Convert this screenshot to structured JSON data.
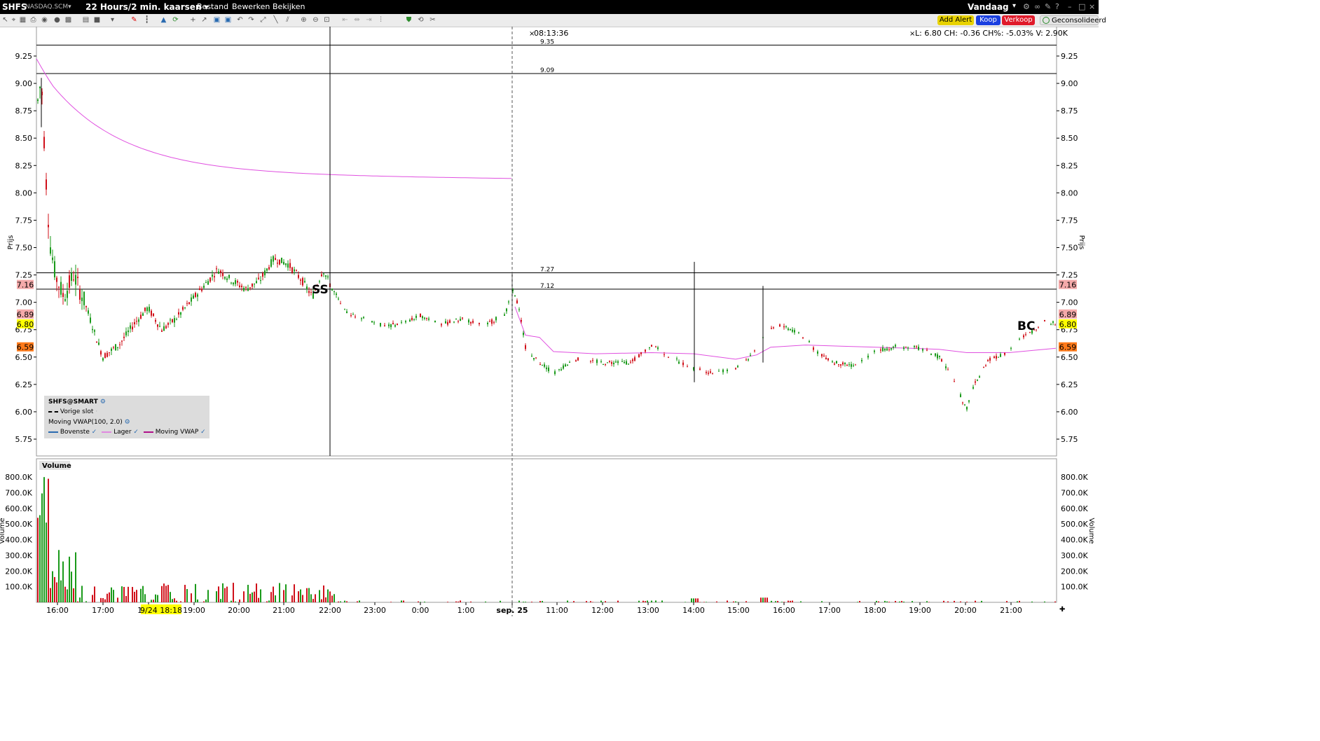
{
  "titlebar": {
    "symbol": "SHFS",
    "exchange": "NASDAQ.SCM▾",
    "timeframe": "22 Hours/2 min. kaarsen ▾",
    "menus": [
      "Bestand",
      "Bewerken",
      "Bekijken"
    ],
    "period_label": "Vandaag",
    "period_arrow": "▾"
  },
  "toolbar": {
    "add_alert": "Add Alert",
    "buy": "Koop",
    "sell": "Verkoop",
    "consolidated": "Geconsolideerd",
    "colors": {
      "add_alert": "#e8d200",
      "buy": "#1a3fe0",
      "sell": "#e01a2a"
    }
  },
  "header": {
    "crosshair_time": "08:13:36",
    "quote": "L: 6.80 CH: -0.36 CH%: -5.03% V: 2.90K"
  },
  "chart_data": {
    "type": "candlestick",
    "price_axis": {
      "label": "Prijs",
      "ticks": [
        "9.25",
        "9.00",
        "8.75",
        "8.50",
        "8.25",
        "8.00",
        "7.75",
        "7.50",
        "7.25",
        "7.00",
        "6.75",
        "6.50",
        "6.25",
        "6.00",
        "5.75"
      ],
      "range": [
        5.62,
        9.35
      ]
    },
    "price_markers": [
      {
        "label": "7.16",
        "value": 7.16,
        "color": "#f4a9a9"
      },
      {
        "label": "6.89",
        "value": 6.89,
        "color": "#f4a9a9"
      },
      {
        "label": "6.80",
        "value": 6.8,
        "color": "#ffff00"
      },
      {
        "label": "6.59",
        "value": 6.59,
        "color": "#ff7a1a"
      }
    ],
    "horizontal_lines": [
      {
        "label": "9.35",
        "value": 9.35
      },
      {
        "label": "9.09",
        "value": 9.09
      },
      {
        "label": "7.27",
        "value": 7.27
      },
      {
        "label": "7.12",
        "value": 7.12
      }
    ],
    "time_axis": {
      "ticks": [
        "16:00",
        "17:00",
        "18:00",
        "19:00",
        "20:00",
        "21:00",
        "22:00",
        "23:00",
        "0:00",
        "1:00",
        "sep. 25",
        "11:00",
        "12:00",
        "13:00",
        "14:00",
        "15:00",
        "16:00",
        "17:00",
        "18:00",
        "19:00",
        "20:00",
        "21:00"
      ],
      "highlight": "9/24 18:18"
    },
    "annotations": [
      "SS",
      "BC"
    ],
    "volume_axis": {
      "label": "Volume",
      "ticks": [
        "800.0K",
        "700.0K",
        "600.0K",
        "500.0K",
        "400.0K",
        "300.0K",
        "200.0K",
        "100.0K"
      ]
    },
    "volume_title": "Volume",
    "vwap_color": "#e050e0",
    "up_color": "#1a9a1a",
    "down_color": "#d0101a"
  },
  "legend": {
    "title": "SHFS@SMART",
    "prev_close": "Vorige slot",
    "study": "Moving VWAP(100, 2.0)",
    "items": [
      "Bovenste",
      "Lager",
      "Moving VWAP"
    ]
  }
}
